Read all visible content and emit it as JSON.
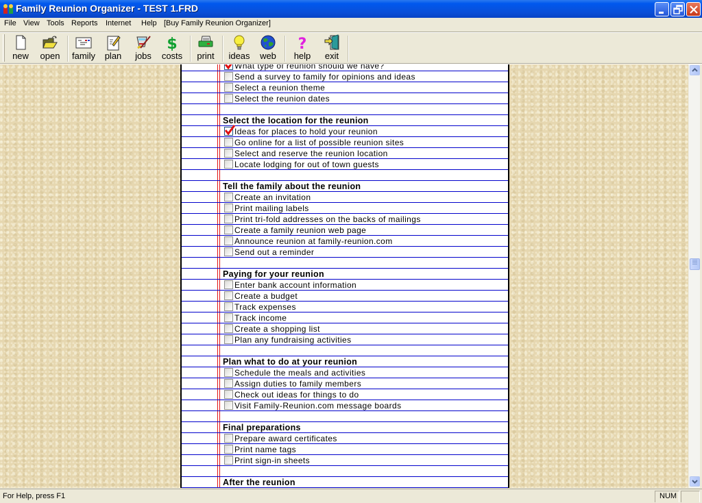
{
  "window": {
    "title": "Family Reunion Organizer - TEST 1.FRD",
    "controls": [
      "minimize",
      "restore",
      "close"
    ]
  },
  "menu": [
    {
      "label": "File"
    },
    {
      "label": "View"
    },
    {
      "label": "Tools"
    },
    {
      "label": "Reports"
    },
    {
      "label": "Internet"
    },
    {
      "label": "Help"
    },
    {
      "label": "[Buy Family Reunion Organizer]"
    }
  ],
  "toolbar": [
    {
      "label": "new",
      "icon": "new-document-icon"
    },
    {
      "label": "open",
      "icon": "open-folder-icon"
    },
    {
      "label": "family",
      "icon": "family-card-icon"
    },
    {
      "label": "plan",
      "icon": "plan-notepad-icon"
    },
    {
      "label": "jobs",
      "icon": "jobs-bucket-icon"
    },
    {
      "label": "costs",
      "icon": "dollar-icon"
    },
    {
      "label": "print",
      "icon": "printer-icon"
    },
    {
      "label": "ideas",
      "icon": "lightbulb-icon"
    },
    {
      "label": "web",
      "icon": "globe-icon"
    },
    {
      "label": "help",
      "icon": "question-mark-icon"
    },
    {
      "label": "exit",
      "icon": "exit-door-icon"
    }
  ],
  "checklist": {
    "rows": [
      {
        "type": "item",
        "text": "What type of reunion should we have?",
        "checked": true
      },
      {
        "type": "item",
        "text": "Send a survey to family for opinions and ideas",
        "checked": false
      },
      {
        "type": "item",
        "text": "Select a reunion theme",
        "checked": false
      },
      {
        "type": "item",
        "text": "Select the reunion dates",
        "checked": false
      },
      {
        "type": "blank"
      },
      {
        "type": "heading",
        "text": "Select the location for the reunion"
      },
      {
        "type": "item",
        "text": "Ideas for places to hold your reunion",
        "checked": true
      },
      {
        "type": "item",
        "text": "Go online for a list of possible reunion sites",
        "checked": false
      },
      {
        "type": "item",
        "text": "Select and reserve the reunion location",
        "checked": false
      },
      {
        "type": "item",
        "text": "Locate lodging for out of town guests",
        "checked": false
      },
      {
        "type": "blank"
      },
      {
        "type": "heading",
        "text": "Tell the family about the reunion"
      },
      {
        "type": "item",
        "text": "Create an invitation",
        "checked": false
      },
      {
        "type": "item",
        "text": "Print mailing labels",
        "checked": false
      },
      {
        "type": "item",
        "text": "Print tri-fold addresses on the backs of mailings",
        "checked": false
      },
      {
        "type": "item",
        "text": "Create a family reunion web page",
        "checked": false
      },
      {
        "type": "item",
        "text": "Announce reunion at family-reunion.com",
        "checked": false
      },
      {
        "type": "item",
        "text": "Send out a reminder",
        "checked": false
      },
      {
        "type": "blank"
      },
      {
        "type": "heading",
        "text": "Paying for your reunion"
      },
      {
        "type": "item",
        "text": "Enter bank account information",
        "checked": false
      },
      {
        "type": "item",
        "text": "Create a budget",
        "checked": false
      },
      {
        "type": "item",
        "text": "Track expenses",
        "checked": false
      },
      {
        "type": "item",
        "text": "Track income",
        "checked": false
      },
      {
        "type": "item",
        "text": "Create a shopping list",
        "checked": false
      },
      {
        "type": "item",
        "text": "Plan any fundraising activities",
        "checked": false
      },
      {
        "type": "blank"
      },
      {
        "type": "heading",
        "text": "Plan what to do at your reunion"
      },
      {
        "type": "item",
        "text": "Schedule the meals and activities",
        "checked": false
      },
      {
        "type": "item",
        "text": "Assign duties to family members",
        "checked": false
      },
      {
        "type": "item",
        "text": "Check out ideas for things to do",
        "checked": false
      },
      {
        "type": "item",
        "text": "Visit Family-Reunion.com message boards",
        "checked": false
      },
      {
        "type": "blank"
      },
      {
        "type": "heading",
        "text": "Final preparations"
      },
      {
        "type": "item",
        "text": "Prepare award certificates",
        "checked": false
      },
      {
        "type": "item",
        "text": "Print name tags",
        "checked": false
      },
      {
        "type": "item",
        "text": "Print sign-in sheets",
        "checked": false
      },
      {
        "type": "blank"
      },
      {
        "type": "heading",
        "text": "After the reunion"
      },
      {
        "type": "item",
        "text": "",
        "checked": false
      }
    ]
  },
  "scroll": {
    "position_fraction": 0.47
  },
  "statusbar": {
    "help_text": "For Help, press F1",
    "num_lock": "NUM"
  },
  "colors": {
    "rule_line": "#0000cc",
    "margin_line": "#e01010",
    "check_mark": "#e01010",
    "desk_background": "#e6d7b0",
    "titlebar": "#0a4fd8"
  }
}
